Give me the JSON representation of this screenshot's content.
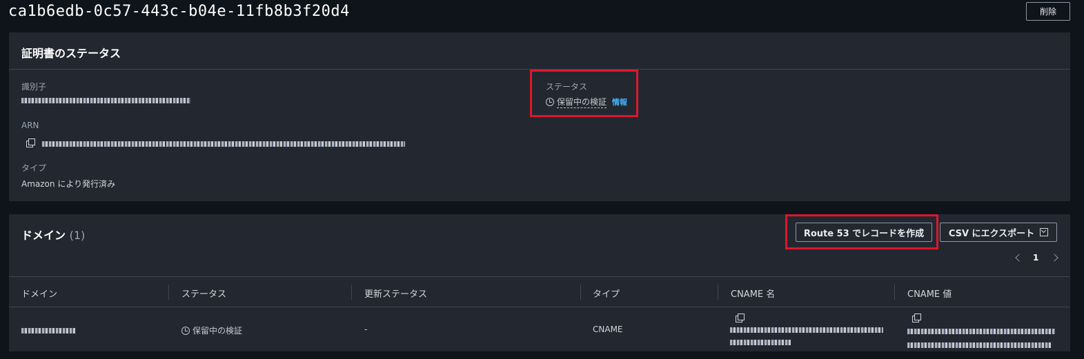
{
  "header": {
    "title": "ca1b6edb-0c57-443c-b04e-11fb8b3f20d4",
    "delete_label": "削除"
  },
  "certificate_status": {
    "title": "証明書のステータス",
    "identifier_label": "識別子",
    "arn_label": "ARN",
    "type_label": "タイプ",
    "type_value": "Amazon により発行済み",
    "status_label": "ステータス",
    "status_value": "保留中の検証",
    "info_label": "情報"
  },
  "domains": {
    "title": "ドメイン",
    "count": "(1)",
    "route53_button": "Route 53 でレコードを作成",
    "csv_button": "CSV にエクスポート",
    "page": "1",
    "columns": [
      "ドメイン",
      "ステータス",
      "更新ステータス",
      "タイプ",
      "CNAME 名",
      "CNAME 値"
    ],
    "rows": [
      {
        "status": "保留中の検証",
        "renewal_status": "-",
        "type": "CNAME"
      }
    ]
  },
  "icons": {
    "copy": "copy-icon",
    "clock": "clock-icon",
    "download": "download-icon",
    "chevron_left": "chevron-left-icon",
    "chevron_right": "chevron-right-icon"
  },
  "colors": {
    "highlight": "#e0162b",
    "info_link": "#42b4ff",
    "panel": "#23272f",
    "background": "#0f141a"
  }
}
